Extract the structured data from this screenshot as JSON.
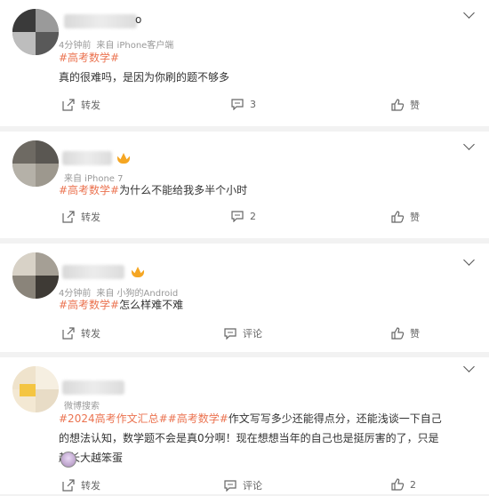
{
  "comments": [
    {
      "time": "4分钟前",
      "source": "来自 iPhone客户端",
      "name_suffix": "o",
      "tags": [
        "#高考数学#"
      ],
      "text": "真的很难吗，是因为你刷的题不够多",
      "repost_label": "转发",
      "comment_count": "3",
      "like_label": "赞"
    },
    {
      "time": "",
      "source": "来自 iPhone 7",
      "tags": [
        "#高考数学#"
      ],
      "text": "为什么不能给我多半个小时",
      "repost_label": "转发",
      "comment_count": "2",
      "like_label": "赞"
    },
    {
      "time": "4分钟前",
      "source": "来自 小狗的Android",
      "tags": [
        "#高考数学#"
      ],
      "text": "怎么样难不难",
      "repost_label": "转发",
      "comment_count": "评论",
      "like_label": "赞"
    },
    {
      "time": "",
      "source": "微博搜索",
      "tags": [
        "#2024高考作文汇总#",
        "#高考数学#"
      ],
      "text": "作文写写多少还能得点分，还能浅谈一下自己的想法认知，数学题不会是真0分啊！现在想想当年的自己也是挺厉害的了，只是越长大越笨蛋",
      "repost_label": "转发",
      "comment_count": "评论",
      "like_count": "2"
    }
  ]
}
